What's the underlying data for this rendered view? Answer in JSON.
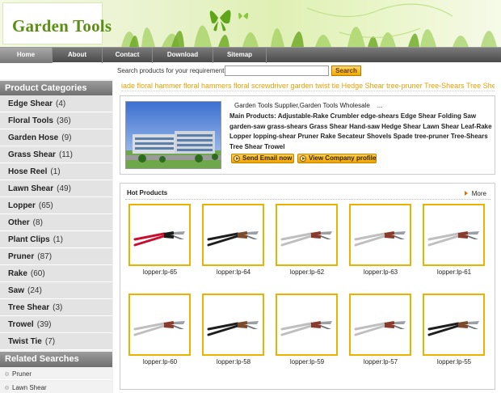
{
  "header": {
    "logo_text": "Garden Tools"
  },
  "nav": {
    "items": [
      "Home",
      "About",
      "Contact",
      "Download",
      "Sitemap"
    ],
    "active": "Home"
  },
  "search": {
    "label": "Search products for your requirement:",
    "value": "",
    "button": "Search"
  },
  "sidebar": {
    "categories_title": "Product Categories",
    "categories": [
      {
        "name": "Edge Shear",
        "count": "(4)"
      },
      {
        "name": "Floral Tools",
        "count": "(36)"
      },
      {
        "name": "Garden Hose",
        "count": "(9)"
      },
      {
        "name": "Grass Shear",
        "count": "(11)"
      },
      {
        "name": "Hose Reel",
        "count": "(1)"
      },
      {
        "name": "Lawn Shear",
        "count": "(49)"
      },
      {
        "name": "Lopper",
        "count": "(65)"
      },
      {
        "name": "Other",
        "count": "(8)"
      },
      {
        "name": "Plant Clips",
        "count": "(1)"
      },
      {
        "name": "Pruner",
        "count": "(87)"
      },
      {
        "name": "Rake",
        "count": "(60)"
      },
      {
        "name": "Saw",
        "count": "(24)"
      },
      {
        "name": "Tree Shear",
        "count": "(3)"
      },
      {
        "name": "Trowel",
        "count": "(39)"
      },
      {
        "name": "Twist Tie",
        "count": "(7)"
      }
    ],
    "related_title": "Related Searches",
    "related": [
      "Pruner",
      "Lawn Shear"
    ]
  },
  "ticker": "iade floral hammer floral hammers floral screwdriver garden twist tie Hedge Shear tree-pruner Tree-Shears Tree Shear edge-s",
  "company": {
    "title": "Garden Tools Supplier,Garden Tools Wholesale",
    "ellipsis": "...",
    "products": "Main Products: Adjustable-Rake Crumbler edge-shears Edge Shear Folding Saw garden-saw grass-shears Grass Shear Hand-saw Hedge Shear Lawn Shear Leaf-Rake Lopper lopping-shear Pruner Rake Secateur Shovels Spade tree-pruner Tree-Shears Tree Shear Trowel",
    "send_email": "Send Email now",
    "view_profile": "View Company profile"
  },
  "hot": {
    "title": "Hot Products",
    "more": "More",
    "products": [
      {
        "label": "lopper:lp-65",
        "icon": "lopper-red-handle-icon"
      },
      {
        "label": "lopper:lp-64",
        "icon": "lopper-black-handle-icon"
      },
      {
        "label": "lopper:lp-62",
        "icon": "lopper-silver-handle-icon"
      },
      {
        "label": "lopper:lp-63",
        "icon": "lopper-silver-handle-icon"
      },
      {
        "label": "lopper:lp-61",
        "icon": "lopper-silver-handle-icon"
      },
      {
        "label": "lopper:lp-60",
        "icon": "lopper-silver-handle-icon"
      },
      {
        "label": "lopper:lp-58",
        "icon": "lopper-black-handle-icon"
      },
      {
        "label": "lopper:lp-59",
        "icon": "lopper-silver-handle-icon"
      },
      {
        "label": "lopper:lp-57",
        "icon": "lopper-silver-handle-icon"
      },
      {
        "label": "lopper:lp-55",
        "icon": "lopper-black-handle-icon"
      }
    ]
  },
  "colors": {
    "accent": "#f0a800",
    "logo": "#5a8f12",
    "ticker": "#e6a000",
    "frame": "#e8b400"
  }
}
